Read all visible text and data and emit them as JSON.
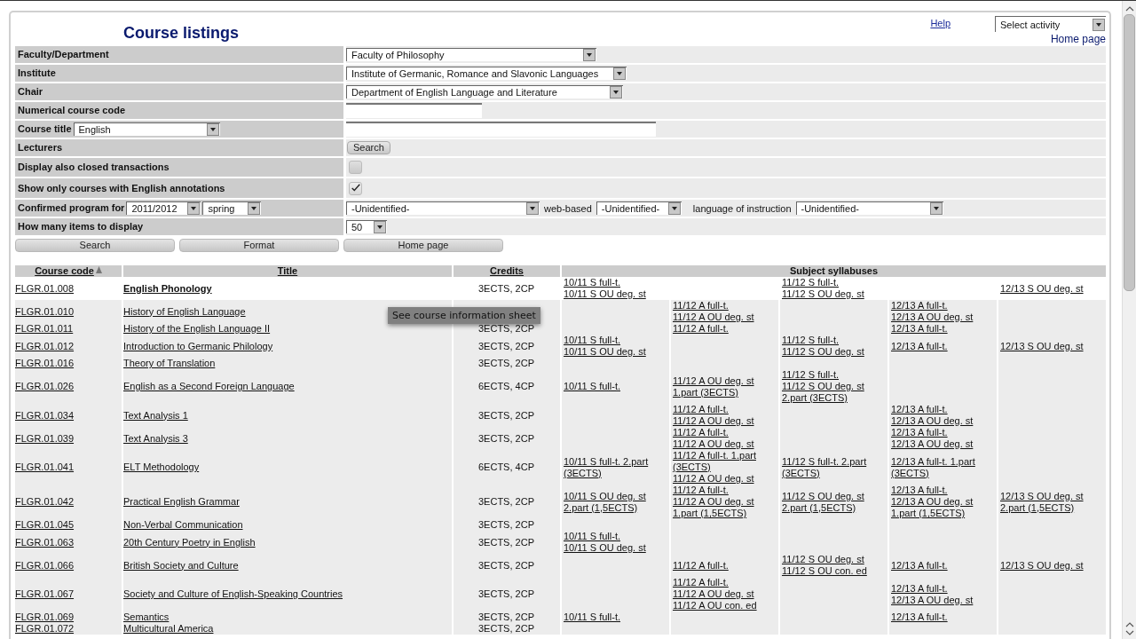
{
  "header": {
    "title": "Course listings",
    "help": "Help",
    "activity": "Select activity",
    "home": "Home page"
  },
  "form": {
    "faculty": {
      "label": "Faculty/Department",
      "value": "Faculty of Philosophy"
    },
    "institute": {
      "label": "Institute",
      "value": "Institute of Germanic, Romance and Slavonic Languages"
    },
    "chair": {
      "label": "Chair",
      "value": "Department of English Language and Literature"
    },
    "course_code": {
      "label": "Numerical course code"
    },
    "course_title": {
      "label": "Course title",
      "value": "English"
    },
    "lecturers": {
      "label": "Lecturers",
      "button": "Search"
    },
    "closed": {
      "label": "Display also closed transactions",
      "checked": false
    },
    "english": {
      "label": "Show only courses with English annotations",
      "checked": true
    },
    "program": {
      "label": "Confirmed program for",
      "year": "2011/2012",
      "term": "spring",
      "type": "-Unidentified-",
      "web_label": "web-based",
      "web_value": "-Unidentified-",
      "lang_label": "language of instruction",
      "lang_value": "-Unidentified-"
    },
    "count": {
      "label": "How many items to display",
      "value": "50"
    }
  },
  "actions": [
    "Search",
    "Format",
    "Home page"
  ],
  "table": {
    "columns": [
      "Course code",
      "Title",
      "Credits",
      "Subject syllabuses"
    ],
    "rows": [
      {
        "code": "FLGR.01.008",
        "title": "English Phonology",
        "credits": "3ECTS, 2CP",
        "hovered": true,
        "syllabi": {
          "column_1": [
            "10/11 S full-t.",
            "10/11 S OU deg. st"
          ],
          "column_3": [
            "11/12 S full-t.",
            "11/12 S OU deg. st"
          ],
          "column_5": [
            "12/13 S OU deg. st"
          ]
        }
      },
      {
        "code": "FLGR.01.010",
        "title": "History of English Language",
        "hovered": false,
        "syllabi": {
          "column_2": [
            "11/12 A full-t.",
            "11/12 A OU deg. st"
          ],
          "column_4": [
            "12/13 A full-t.",
            "12/13 A OU deg. st"
          ]
        }
      },
      {
        "code": "FLGR.01.011",
        "title": "History of the English Language II",
        "credits": "3ECTS, 2CP",
        "hovered": false,
        "syllabi": {
          "column_2": [
            "11/12 A full-t."
          ],
          "column_4": [
            "12/13 A full-t."
          ]
        }
      },
      {
        "code": "FLGR.01.012",
        "title": "Introduction to Germanic Philology",
        "credits": "3ECTS, 2CP",
        "hovered": false,
        "syllabi": {
          "column_1": [
            "10/11 S full-t.",
            "10/11 S OU deg. st"
          ],
          "column_3": [
            "11/12 S full-t.",
            "11/12 S OU deg. st"
          ],
          "column_4": [
            "12/13 A full-t."
          ],
          "column_5": [
            "12/13 S OU deg. st"
          ]
        }
      },
      {
        "code": "FLGR.01.016",
        "title": "Theory of Translation",
        "credits": "3ECTS, 2CP",
        "hovered": false
      },
      {
        "code": "FLGR.01.026",
        "title": "English as a Second Foreign Language",
        "credits": "6ECTS, 4CP",
        "hovered": false,
        "syllabi": {
          "column_1": [
            "10/11 S full-t."
          ],
          "column_2": [
            "11/12 A OU deg. st",
            "1.part (3ECTS)"
          ],
          "column_3": [
            "11/12 S full-t.",
            "11/12 S OU deg. st",
            "2.part (3ECTS)"
          ]
        }
      },
      {
        "code": "FLGR.01.034",
        "title": "Text Analysis 1",
        "credits": "3ECTS, 2CP",
        "hovered": false,
        "syllabi": {
          "column_2": [
            "11/12 A full-t.",
            "11/12 A OU deg. st"
          ],
          "column_4": [
            "12/13 A full-t.",
            "12/13 A OU deg. st"
          ]
        }
      },
      {
        "code": "FLGR.01.039",
        "title": "Text Analysis 3",
        "credits": "3ECTS, 2CP",
        "hovered": false,
        "syllabi": {
          "column_2": [
            "11/12 A full-t.",
            "11/12 A OU deg. st"
          ],
          "column_4": [
            "12/13 A full-t.",
            "12/13 A OU deg. st"
          ]
        }
      },
      {
        "code": "FLGR.01.041",
        "title": "ELT Methodology",
        "credits": "6ECTS, 4CP",
        "hovered": false,
        "syllabi": {
          "column_1": [
            "10/11 S full-t. 2.part",
            "(3ECTS)"
          ],
          "column_2": [
            "11/12 A full-t. 1.part",
            "(3ECTS)",
            "11/12 A OU deg. st"
          ],
          "column_3": [
            "11/12 S full-t. 2.part",
            "(3ECTS)"
          ],
          "column_4": [
            "12/13 A full-t. 1.part",
            "(3ECTS)"
          ]
        }
      },
      {
        "code": "FLGR.01.042",
        "title": "Practical English Grammar",
        "credits": "3ECTS, 2CP",
        "hovered": false,
        "syllabi": {
          "column_1": [
            "10/11 S OU deg. st",
            "2.part (1,5ECTS)"
          ],
          "column_2": [
            "11/12 A full-t.",
            "11/12 A OU deg. st",
            "1.part (1,5ECTS)"
          ],
          "column_3": [
            "11/12 S OU deg. st",
            "2.part (1,5ECTS)"
          ],
          "column_4": [
            "12/13 A full-t.",
            "12/13 A OU deg. st",
            "1.part (1,5ECTS)"
          ],
          "column_5": [
            "12/13 S OU deg. st",
            "2.part (1,5ECTS)"
          ]
        }
      },
      {
        "code": "FLGR.01.045",
        "title": "Non-Verbal Communication",
        "credits": "3ECTS, 2CP",
        "hovered": false
      },
      {
        "code": "FLGR.01.063",
        "title": "20th Century Poetry in English",
        "credits": "3ECTS, 2CP",
        "hovered": false,
        "syllabi": {
          "column_1": [
            "10/11 S full-t.",
            "10/11 S OU deg. st"
          ]
        }
      },
      {
        "code": "FLGR.01.066",
        "title": "British Society and Culture",
        "credits": "3ECTS, 2CP",
        "hovered": false,
        "syllabi": {
          "column_2": [
            "11/12 A full-t."
          ],
          "column_3": [
            "11/12 S OU deg. st",
            "11/12 S OU con. ed"
          ],
          "column_4": [
            "12/13 A full-t."
          ],
          "column_5": [
            "12/13 S OU deg. st"
          ]
        }
      },
      {
        "code": "FLGR.01.067",
        "title": "Society and Culture of English-Speaking Countries",
        "credits": "3ECTS, 2CP",
        "hovered": false,
        "syllabi": {
          "column_2": [
            "11/12 A full-t.",
            "11/12 A OU deg. st",
            "11/12 A OU con. ed"
          ],
          "column_4": [
            "12/13 A full-t.",
            "12/13 A OU deg. st"
          ]
        }
      },
      {
        "code": "FLGR.01.069",
        "title": "Semantics",
        "credits": "3ECTS, 2CP",
        "hovered": false,
        "syllabi": {
          "column_1": [
            "10/11 S full-t."
          ],
          "column_4": [
            "12/13 A full-t."
          ]
        }
      },
      {
        "code": "FLGR.01.072",
        "title": "Multicultural America",
        "credits": "3ECTS, 2CP",
        "hovered": false
      }
    ]
  },
  "tooltip": "See course information sheet"
}
